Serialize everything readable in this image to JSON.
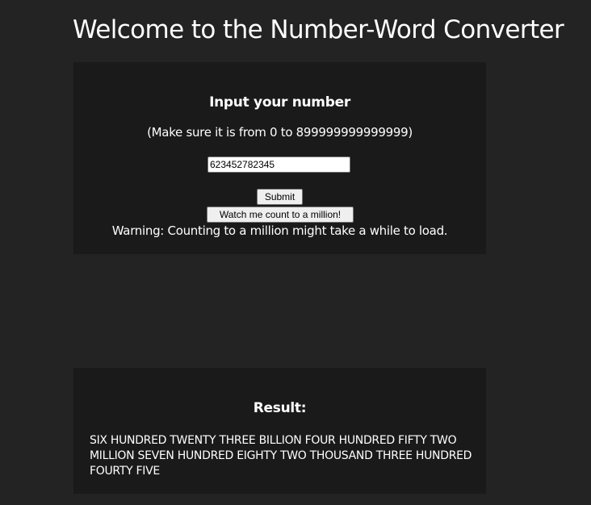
{
  "page": {
    "title": "Welcome to the Number-Word Converter"
  },
  "input_section": {
    "heading": "Input your number",
    "range_note": "(Make sure it is from 0 to 899999999999999)",
    "number_value": "623452782345",
    "submit_label": "Submit",
    "count_button_label": "Watch me count to a million!",
    "warning": "Warning: Counting to a million might take a while to load."
  },
  "result_section": {
    "heading": "Result:",
    "text": "SIX HUNDRED TWENTY THREE BILLION FOUR HUNDRED FIFTY TWO MILLION SEVEN HUNDRED EIGHTY TWO THOUSAND THREE HUNDRED FOURTY FIVE"
  },
  "colors": {
    "page_background": "#232323",
    "panel_background": "#1a1a1a",
    "text": "#ffffff",
    "button_background": "#efefef"
  }
}
